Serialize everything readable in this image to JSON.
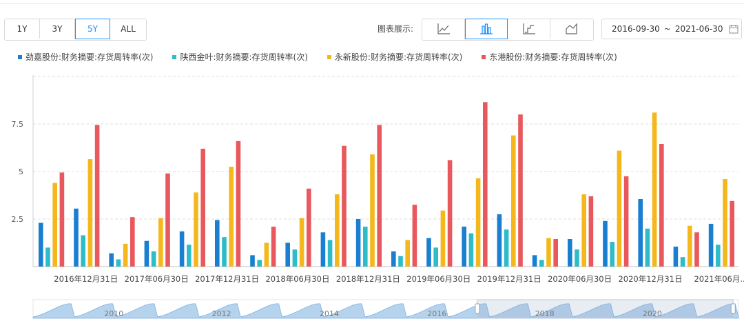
{
  "range_buttons": [
    "1Y",
    "3Y",
    "5Y",
    "ALL"
  ],
  "range_active": "5Y",
  "chart_type_label": "图表展示:",
  "chart_type_icons": [
    "line-chart-icon",
    "bar-chart-icon",
    "step-chart-icon",
    "area-chart-icon"
  ],
  "date_range": {
    "start": "2016-09-30",
    "separator": "~",
    "end": "2021-06-30"
  },
  "colors": {
    "accent": "#1890ff",
    "series": [
      "#1a7fd1",
      "#2fbcc9",
      "#f5b81c",
      "#e8585c"
    ]
  },
  "chart_data": {
    "type": "bar",
    "categories": [
      "2016-09-30",
      "2016-12-31",
      "2017-03-31",
      "2017-06-30",
      "2017-09-30",
      "2017-12-31",
      "2018-03-31",
      "2018-06-30",
      "2018-09-30",
      "2018-12-31",
      "2019-03-31",
      "2019-06-30",
      "2019-09-30",
      "2019-12-31",
      "2020-03-31",
      "2020-06-30",
      "2020-09-30",
      "2020-12-31",
      "2021-03-31",
      "2021-06-30"
    ],
    "tick_labels": [
      "2016年12月31日",
      "2017年06月30日",
      "2017年12月31日",
      "2018年06月30日",
      "2018年12月31日",
      "2019年06月30日",
      "2019年12月31日",
      "2020年06月30日",
      "2020年12月31日",
      "2021年06月..."
    ],
    "series": [
      {
        "name": "劲嘉股份:财务摘要:存货周转率(次)",
        "values": [
          2.3,
          3.05,
          0.7,
          1.35,
          1.85,
          2.45,
          0.6,
          1.25,
          1.8,
          2.5,
          0.8,
          1.5,
          2.1,
          2.75,
          0.6,
          1.45,
          2.4,
          3.55,
          1.05,
          2.25
        ]
      },
      {
        "name": "陕西金叶:财务摘要:存货周转率(次)",
        "values": [
          1.0,
          1.65,
          0.38,
          0.8,
          1.15,
          1.55,
          0.35,
          0.9,
          1.4,
          2.1,
          0.55,
          1.0,
          1.75,
          1.95,
          0.35,
          0.9,
          1.3,
          2.0,
          0.5,
          1.15
        ]
      },
      {
        "name": "永新股份:财务摘要:存货周转率(次)",
        "values": [
          4.4,
          5.65,
          1.2,
          2.55,
          3.9,
          5.25,
          1.25,
          2.55,
          3.8,
          5.9,
          1.4,
          2.95,
          4.65,
          6.9,
          1.5,
          3.8,
          6.1,
          8.1,
          2.15,
          4.6
        ]
      },
      {
        "name": "东港股份:财务摘要:存货周转率(次)",
        "values": [
          4.95,
          7.45,
          2.6,
          4.9,
          6.2,
          6.6,
          2.1,
          4.1,
          6.35,
          7.45,
          3.25,
          5.6,
          8.65,
          8.0,
          1.45,
          3.7,
          4.75,
          6.45,
          1.8,
          3.45
        ]
      }
    ],
    "ylim": [
      0,
      10
    ],
    "yticks": [
      "2.5",
      "5",
      "7.5"
    ],
    "ytick_values": [
      2.5,
      5,
      7.5
    ],
    "grid": true,
    "legend": "top-left",
    "navigator": {
      "labels": [
        "2010",
        "2012",
        "2014",
        "2016",
        "2018",
        "2020"
      ],
      "label_values": [
        2010,
        2012,
        2014,
        2016,
        2018,
        2020
      ],
      "selection": [
        2016.75,
        2021.5
      ],
      "span": [
        2008.5,
        2021.6
      ]
    }
  }
}
